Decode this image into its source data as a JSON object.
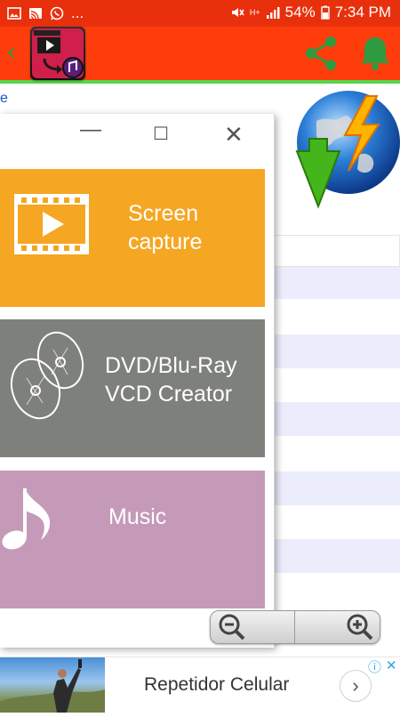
{
  "status_bar": {
    "ellipsis": "...",
    "battery": "54%",
    "time": "7:34 PM",
    "network_label": "H+",
    "icons": [
      "image-icon",
      "cast-icon",
      "whatsapp-icon",
      "mute-icon",
      "signal-icon",
      "battery-icon"
    ]
  },
  "app_bar": {
    "back_icon": "back-chevron-icon",
    "logo": "video-to-audio-logo",
    "actions": [
      "share-icon",
      "bell-icon"
    ]
  },
  "window": {
    "controls": [
      "minimize",
      "maximize",
      "close"
    ],
    "tiles": [
      {
        "label": "Screen\ncapture",
        "icon": "film-play-icon",
        "color": "#f5a623"
      },
      {
        "label": "DVD/Blu-Ray\nVCD Creator",
        "icon": "disc-icon",
        "color": "#7e807b"
      },
      {
        "label": "Music",
        "icon": "music-note-icon",
        "color": "#c49ab8"
      }
    ]
  },
  "background": {
    "link_fragment": "e",
    "graphic": "globe-lightning-download-icon"
  },
  "zoom": {
    "out_icon": "zoom-out-icon",
    "in_icon": "zoom-in-icon"
  },
  "ad": {
    "title": "Repetidor Celular",
    "arrow": "›",
    "info_icon": "info-icon",
    "close_icon": "close-icon"
  },
  "colors": {
    "status_bar": "#e8300c",
    "app_bar": "#ff3c0c",
    "accent_green": "#57d64b",
    "stripe": "#ecedfc"
  }
}
